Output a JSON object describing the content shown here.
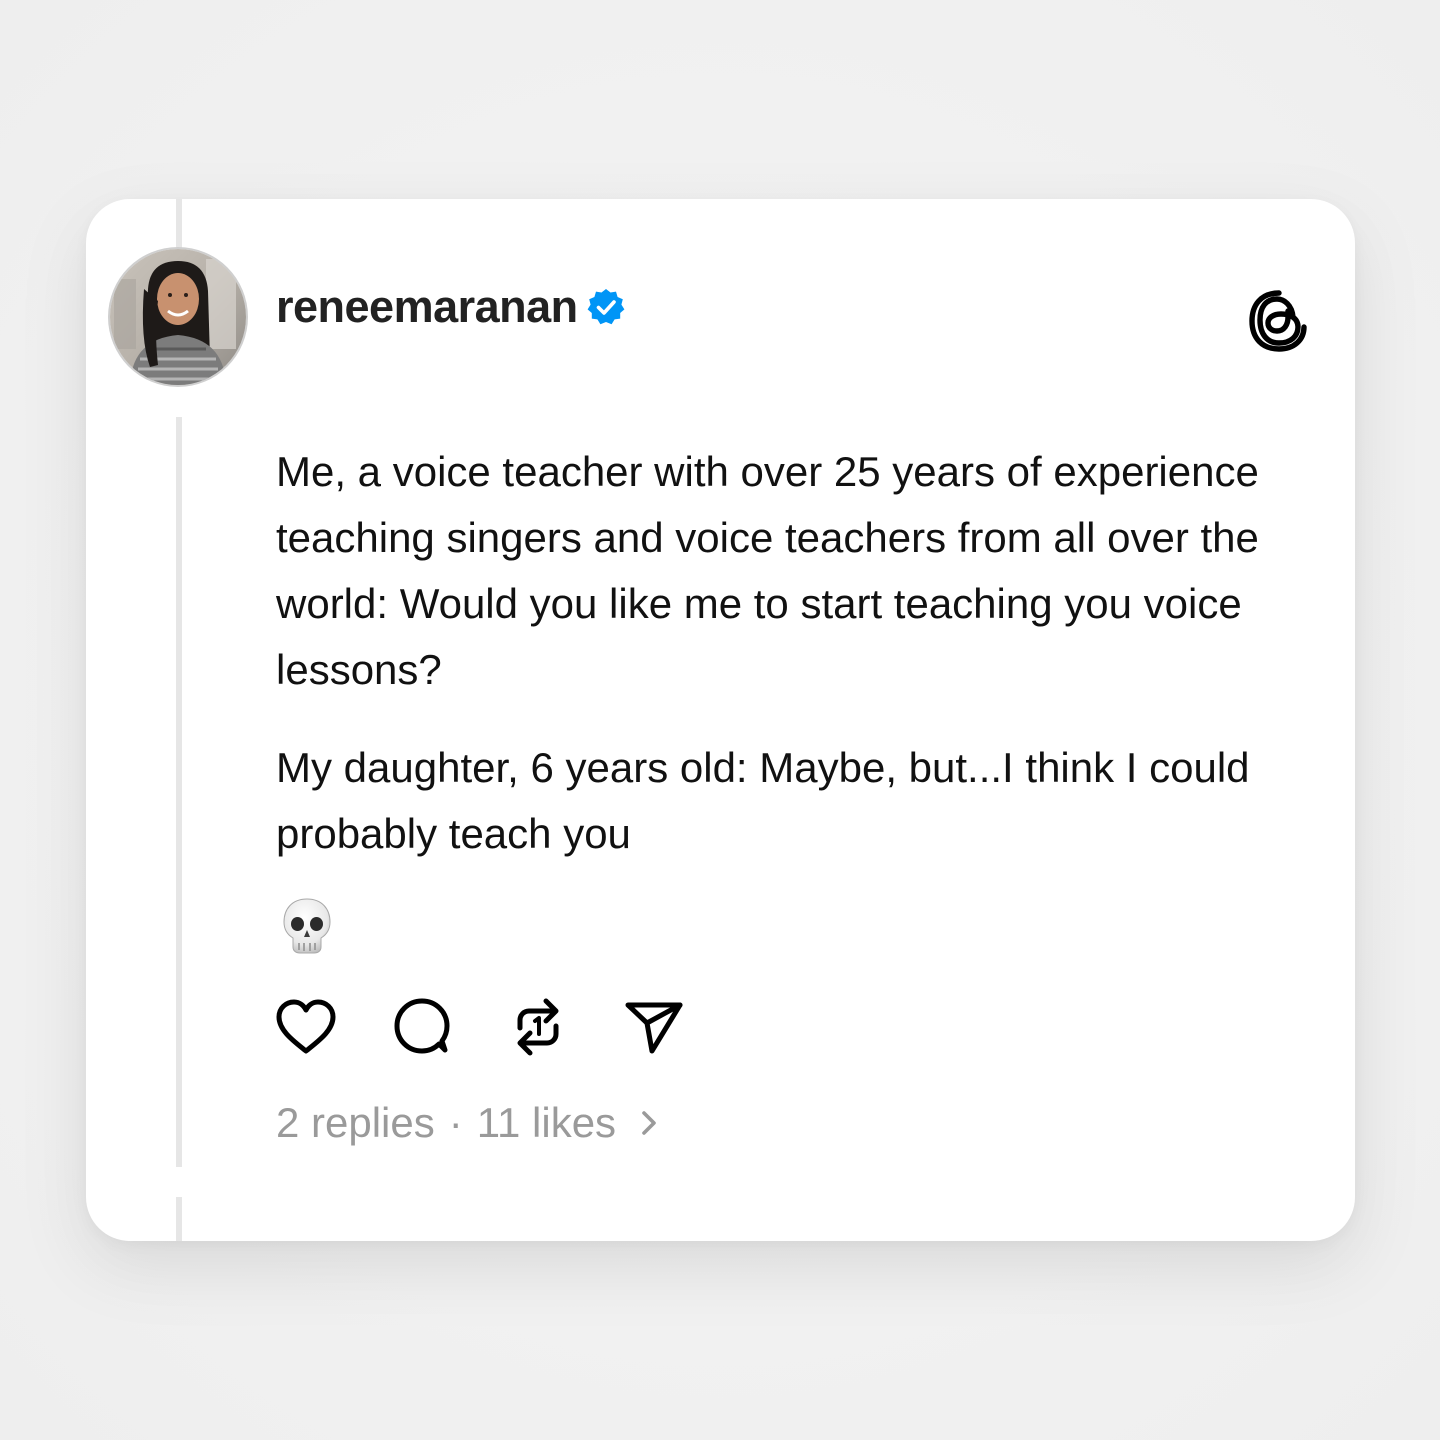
{
  "post": {
    "username": "reneemaranan",
    "verified": true,
    "paragraphs": [
      "Me, a voice teacher with over 25 years of experience teaching singers and voice teachers from all over the world: Would you like me to start teaching you voice lessons?",
      "My daughter, 6 years old: Maybe, but...I think I could probably teach you"
    ],
    "emoji": "skull",
    "replies_label": "2 replies",
    "separator": "·",
    "likes_label": "11 likes"
  },
  "icons": {
    "logo": "threads-logo-icon",
    "verified": "verified-badge-icon",
    "like": "heart-icon",
    "reply": "comment-bubble-icon",
    "repost": "repost-icon",
    "share": "send-icon",
    "more": "chevron-right-icon"
  },
  "colors": {
    "verified_blue": "#0095F6",
    "text_primary": "#111111",
    "text_muted": "#9A9A9A",
    "thread_line": "#E6E6E6"
  }
}
